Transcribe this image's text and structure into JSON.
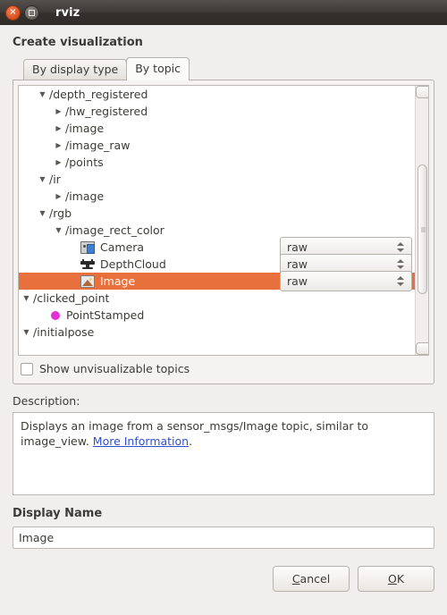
{
  "window": {
    "title": "rviz",
    "close_label": "×",
    "maximize_label": ""
  },
  "heading": "Create visualization",
  "tabs": [
    {
      "label": "By display type",
      "active": false
    },
    {
      "label": "By topic",
      "active": true
    }
  ],
  "tree": {
    "rows": [
      {
        "indent": 1,
        "arrow": "▼",
        "label": "/depth_registered",
        "icon": "none",
        "selected": false,
        "combo": null
      },
      {
        "indent": 2,
        "arrow": "▶",
        "label": "/hw_registered",
        "icon": "none",
        "selected": false,
        "combo": null
      },
      {
        "indent": 2,
        "arrow": "▶",
        "label": "/image",
        "icon": "none",
        "selected": false,
        "combo": null
      },
      {
        "indent": 2,
        "arrow": "▶",
        "label": "/image_raw",
        "icon": "none",
        "selected": false,
        "combo": null
      },
      {
        "indent": 2,
        "arrow": "▶",
        "label": "/points",
        "icon": "none",
        "selected": false,
        "combo": null
      },
      {
        "indent": 1,
        "arrow": "▼",
        "label": "/ir",
        "icon": "none",
        "selected": false,
        "combo": null
      },
      {
        "indent": 2,
        "arrow": "▶",
        "label": "/image",
        "icon": "none",
        "selected": false,
        "combo": null
      },
      {
        "indent": 1,
        "arrow": "▼",
        "label": "/rgb",
        "icon": "none",
        "selected": false,
        "combo": null
      },
      {
        "indent": 2,
        "arrow": "▼",
        "label": "/image_rect_color",
        "icon": "none",
        "selected": false,
        "combo": null
      },
      {
        "indent": 3,
        "arrow": "",
        "label": "Camera",
        "icon": "camera-icon",
        "selected": false,
        "combo": "raw"
      },
      {
        "indent": 3,
        "arrow": "",
        "label": "DepthCloud",
        "icon": "depthcloud-icon",
        "selected": false,
        "combo": "raw"
      },
      {
        "indent": 3,
        "arrow": "",
        "label": "Image",
        "icon": "image-icon",
        "selected": true,
        "combo": "raw"
      },
      {
        "indent": 0,
        "arrow": "▼",
        "label": "/clicked_point",
        "icon": "none",
        "selected": false,
        "combo": null
      },
      {
        "indent": 1,
        "arrow": "",
        "label": "PointStamped",
        "icon": "dot-icon",
        "selected": false,
        "combo": null
      },
      {
        "indent": 0,
        "arrow": "▼",
        "label": "/initialpose",
        "icon": "none",
        "selected": false,
        "combo": null
      }
    ],
    "selection_color": "#e8703c"
  },
  "show_unvisualizable": {
    "label": "Show unvisualizable topics",
    "checked": false
  },
  "description": {
    "label": "Description:",
    "text_before": "Displays an image from a sensor_msgs/Image topic, similar to image_view. ",
    "link_text": "More Information",
    "text_after": "."
  },
  "display_name": {
    "label": "Display Name",
    "value": "Image"
  },
  "buttons": {
    "cancel": {
      "mnemonic": "C",
      "rest": "ancel"
    },
    "ok": {
      "mnemonic": "O",
      "rest": "K"
    }
  }
}
